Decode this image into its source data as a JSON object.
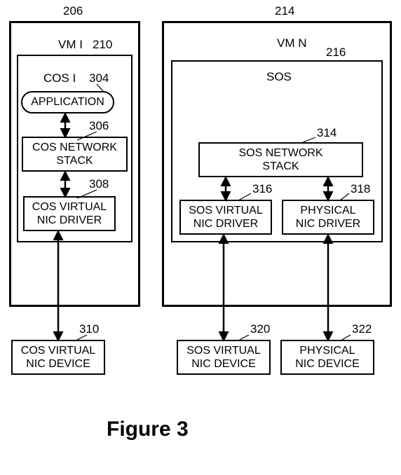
{
  "refs": {
    "vm1_outer": "206",
    "vm1_inner": "210",
    "vmN_outer": "214",
    "vmN_inner": "216",
    "app": "304",
    "cos_stack": "306",
    "cos_vdrv": "308",
    "cos_vdev": "310",
    "sos_stack": "314",
    "sos_vdrv": "316",
    "phy_drv": "318",
    "sos_vdev": "320",
    "phy_dev": "322"
  },
  "labels": {
    "vm1": "VM I",
    "vmN": "VM N",
    "cos1": "COS I",
    "sos": "SOS",
    "application": "APPLICATION",
    "cos_network": "COS NETWORK",
    "stack": "STACK",
    "cos_virtual": "COS VIRTUAL",
    "nic_driver": "NIC DRIVER",
    "nic_device": "NIC DEVICE",
    "sos_network": "SOS NETWORK",
    "sos_virtual": "SOS VIRTUAL",
    "physical": "PHYSICAL"
  },
  "figure": "Figure 3"
}
